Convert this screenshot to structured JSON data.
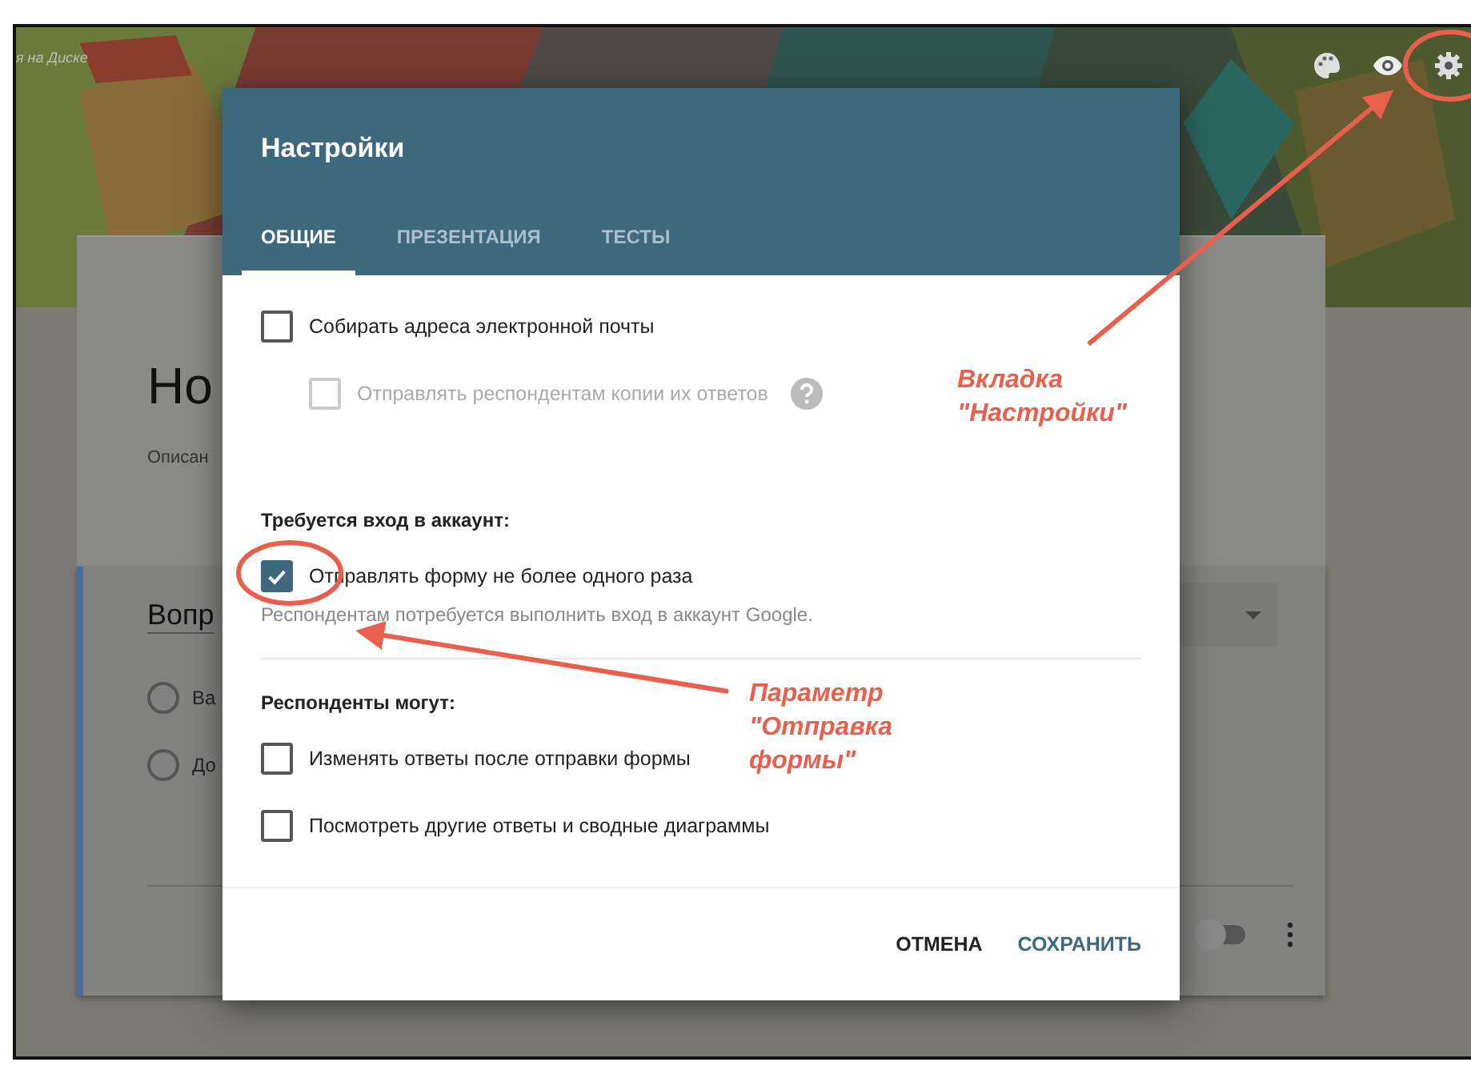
{
  "page": {
    "save_status": "я на Диске",
    "form_title": "Но",
    "form_description": "Описан",
    "question_title": "Вопр",
    "options": [
      {
        "label": "Ва",
        "selected": false
      },
      {
        "label": "До",
        "selected": false
      }
    ],
    "required_on": false
  },
  "dialog": {
    "title": "Настройки",
    "tabs": [
      {
        "label": "ОБЩИЕ",
        "selected": true
      },
      {
        "label": "ПРЕЗЕНТАЦИЯ",
        "selected": false
      },
      {
        "label": "ТЕСТЫ",
        "selected": false
      }
    ],
    "sections": [
      {
        "items": [
          {
            "label": "Собирать адреса электронной почты",
            "checked": false,
            "disabled": false,
            "children": [
              {
                "label": "Отправлять респондентам копии их ответов",
                "checked": false,
                "disabled": true,
                "help": true
              }
            ]
          }
        ]
      },
      {
        "heading": "Требуется вход в аккаунт:",
        "items": [
          {
            "label": "Отправлять форму не более одного раза",
            "checked": true,
            "disabled": false,
            "note": "Респондентам потребуется выполнить вход в аккаунт Google."
          }
        ]
      },
      {
        "heading": "Респонденты могут:",
        "items": [
          {
            "label": "Изменять ответы после отправки формы",
            "checked": false,
            "disabled": false
          },
          {
            "label": "Посмотреть другие ответы и сводные диаграммы",
            "checked": false,
            "disabled": false
          }
        ]
      }
    ],
    "buttons": [
      {
        "label": "ОТМЕНА",
        "kind": "plain"
      },
      {
        "label": "СОХРАНИТЬ",
        "kind": "primary"
      }
    ]
  },
  "annotations": [
    {
      "lines": [
        "Вкладка",
        "\"Настройки\""
      ]
    },
    {
      "lines": [
        "Параметр",
        "\"Отправка",
        "формы\""
      ]
    }
  ]
}
